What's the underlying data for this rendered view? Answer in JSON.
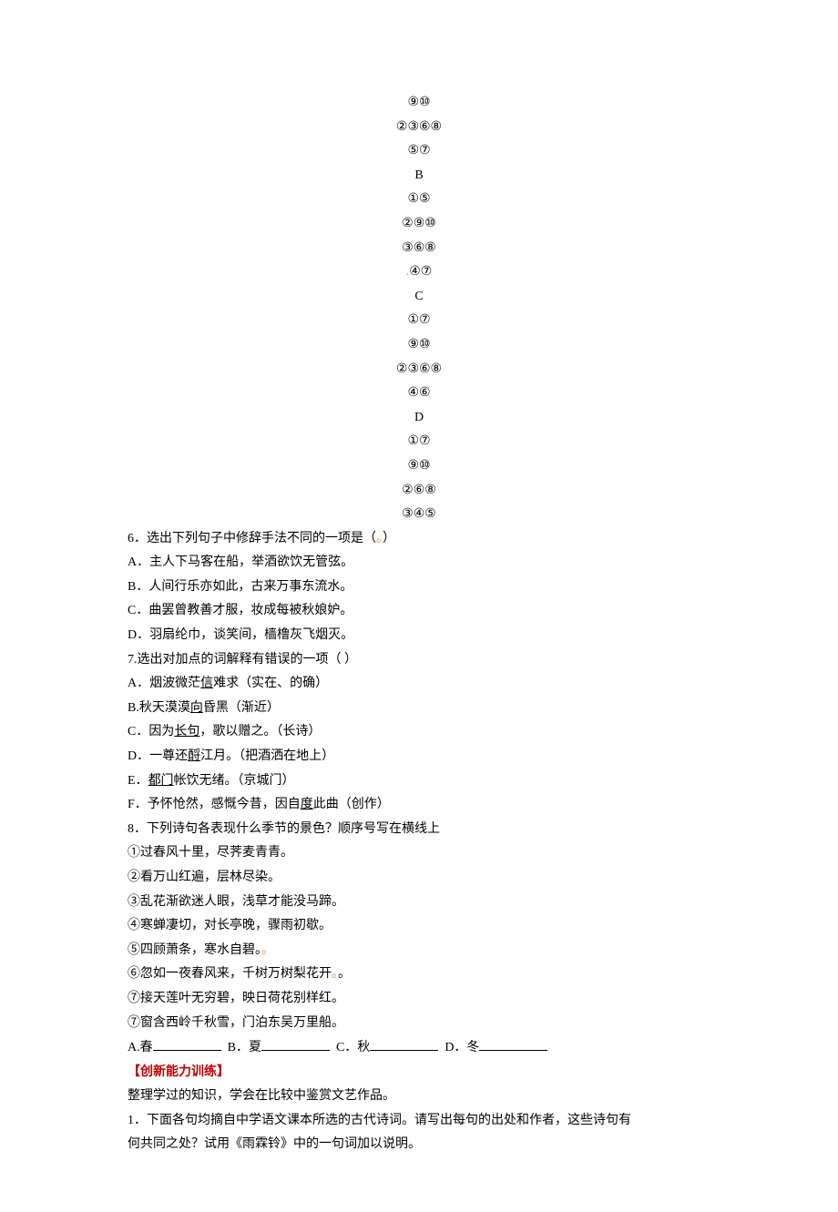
{
  "center": {
    "l1": "⑨⑩",
    "l2": "②③⑥⑧",
    "l3": "⑤⑦",
    "l4": "B",
    "l5": "①⑤",
    "l6": "②⑨⑩",
    "l7": "③⑥⑧",
    "l8a": ".",
    "l8b": "④⑦",
    "l9": "C",
    "l10": "①⑦",
    "l11": "⑨⑩",
    "l12": "②③⑥⑧",
    "l13": "④⑥",
    "l14": "D",
    "l15": "①⑦",
    "l16": "⑨⑩",
    "l17": "②⑥⑧",
    "l18": "③④⑤"
  },
  "q6": {
    "stem_a": "6．选出下列句子中修辞手法不同的一项是（",
    "dot": "。",
    "stem_b": "）",
    "A": "A．主人下马客在船，举酒欲饮无管弦。",
    "B": "B．人间行乐亦如此，古来万事东流水。",
    "C": "C．曲罢曾教善才服，妆成每被秋娘妒。",
    "D": "D．羽扇纶巾，谈笑间，樯橹灰飞烟灭。"
  },
  "q7": {
    "stem": "7.选出对加点的词解释有错误的一项（  ）",
    "A_a": "A．烟波微茫",
    "A_u": "信",
    "A_b": "难求（实在、的确）",
    "B_a": "B.秋天漠漠",
    "B_u": "向",
    "B_b": "昏黑（渐近）",
    "C_a": "C．因为",
    "C_u": "长句",
    "C_b": "，歌以赠之。（长诗）",
    "D_a": "D．一尊还",
    "D_u": "酹",
    "D_b": "江月。（把酒洒在地上）",
    "E_a": "E．",
    "E_u": "都门",
    "E_b": "帐饮无绪。（京城门）",
    "F_a": "F．予怀怆然，感慨今昔，因自",
    "F_u": "度",
    "F_b": "此曲（创作）"
  },
  "q8": {
    "stem": "8．下列诗句各表现什么季节的景色？顺序号写在横线上",
    "o1": "①过春风十里，尽荠麦青青。",
    "o2": "②看万山红遍，层林尽染。",
    "o3": "③乱花渐欲迷人眼，浅草才能没马蹄。",
    "o4": "④寒蝉凄切，对长亭晚，骤雨初歇。",
    "o5a": "⑤四顾萧条，寒水自碧。",
    "o5b": "。",
    "o6a": "⑥忽如一夜春风来，千树万树梨花开",
    "o6b": "。",
    "o6c": "。",
    "o7": "⑦接天莲叶无穷碧，映日荷花别样红。",
    "o8": "⑦窗含西岭千秋雪，门泊东吴万里船。",
    "fillA": "A.春",
    "fillB": "B．夏",
    "fillC": "C．秋",
    "fillD": "D．冬"
  },
  "section": {
    "heading": "【创新能力训练】",
    "intro": "整理学过的知识，学会在比较中鉴赏文艺作品。",
    "q1a": "1．下面各句均摘自中学语文课本所选的古代诗词。请写出每句的出处和作者，这些诗句有",
    "q1b": "何共同之处？试用《雨霖铃》中的一句词加以说明。"
  }
}
